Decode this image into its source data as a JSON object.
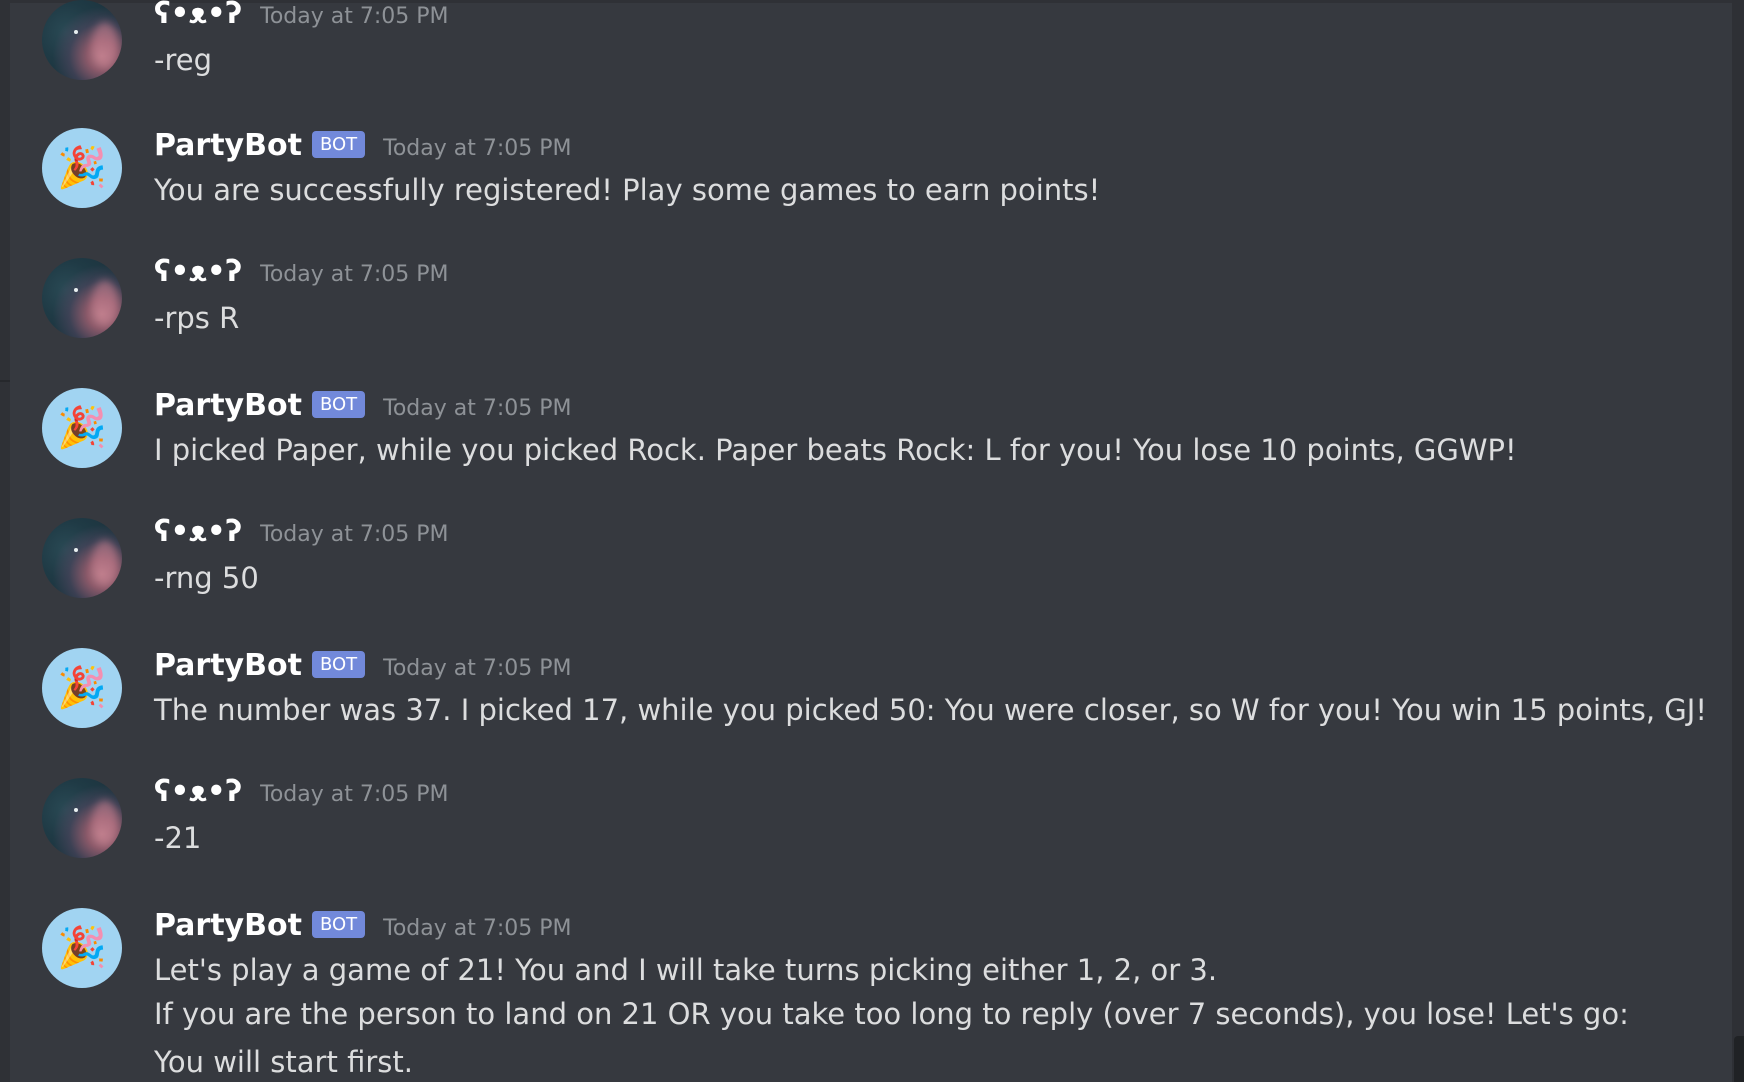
{
  "messages": [
    {
      "author": "ʕ•ᴥ•ʔ",
      "is_bot": false,
      "timestamp": "Today at 7:05 PM",
      "lines": [
        "-reg"
      ]
    },
    {
      "author": "PartyBot",
      "is_bot": true,
      "bot_tag": "BOT",
      "timestamp": "Today at 7:05 PM",
      "lines": [
        "You are successfully registered! Play some games to earn points!"
      ]
    },
    {
      "author": "ʕ•ᴥ•ʔ",
      "is_bot": false,
      "timestamp": "Today at 7:05 PM",
      "lines": [
        "-rps R"
      ]
    },
    {
      "author": "PartyBot",
      "is_bot": true,
      "bot_tag": "BOT",
      "timestamp": "Today at 7:05 PM",
      "lines": [
        "I picked Paper, while you picked Rock. Paper beats Rock: L for you! You lose 10 points, GGWP!"
      ]
    },
    {
      "author": "ʕ•ᴥ•ʔ",
      "is_bot": false,
      "timestamp": "Today at 7:05 PM",
      "lines": [
        "-rng 50"
      ]
    },
    {
      "author": "PartyBot",
      "is_bot": true,
      "bot_tag": "BOT",
      "timestamp": "Today at 7:05 PM",
      "lines": [
        "The number was 37. I picked 17, while you picked 50: You were closer, so W for you! You win 15 points, GJ!"
      ]
    },
    {
      "author": "ʕ•ᴥ•ʔ",
      "is_bot": false,
      "timestamp": "Today at 7:05 PM",
      "lines": [
        "-21"
      ]
    },
    {
      "author": "PartyBot",
      "is_bot": true,
      "bot_tag": "BOT",
      "timestamp": "Today at 7:05 PM",
      "lines": [
        "Let's play a game of 21! You and I will take turns picking either 1, 2, or 3.",
        "If you are the person to land on 21 OR you take too long to reply (over 7 seconds), you lose! Let's go:",
        "You will start first."
      ]
    }
  ],
  "icons": {
    "user_avatar": "night-sky-avatar",
    "bot_avatar": "party-popper-icon"
  },
  "colors": {
    "background": "#36393f",
    "bot_tag": "#7289da",
    "bot_avatar_bg": "#a1d4f2",
    "timestamp": "#8e9297",
    "text": "#dcddde"
  }
}
